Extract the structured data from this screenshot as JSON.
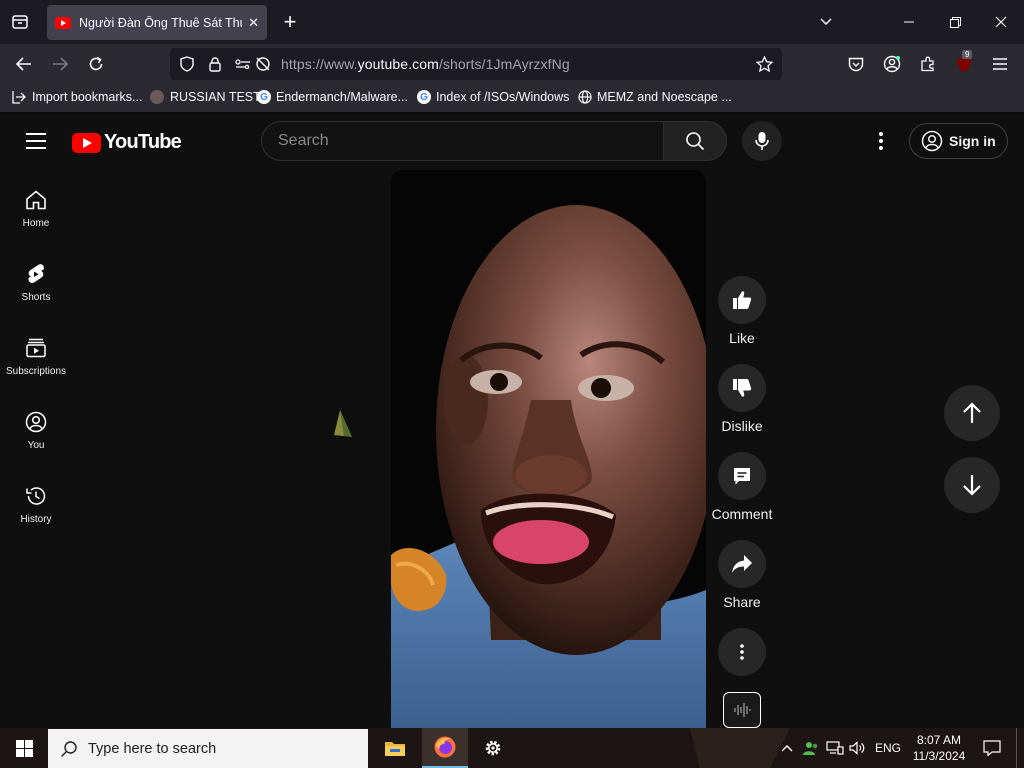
{
  "browser": {
    "tab_title": "Người Đàn Ông Thuê Sát Thủ H",
    "new_tab": "+",
    "url_prefix": "https://www.",
    "url_host": "youtube.com",
    "url_path": "/shorts/1JmAyrzxfNg",
    "extension_badge": "9",
    "bookmarks": [
      "Import bookmarks...",
      "RUSSIAN TEST",
      "Endermanch/Malware...",
      "Index of /ISOs/Windows",
      "MEMZ and Noescape ..."
    ]
  },
  "youtube": {
    "logo_text": "YouTube",
    "search_placeholder": "Search",
    "sign_in": "Sign in",
    "sidebar": [
      {
        "label": "Home",
        "icon": "home-icon"
      },
      {
        "label": "Shorts",
        "icon": "shorts-icon"
      },
      {
        "label": "Subscriptions",
        "icon": "subscriptions-icon"
      },
      {
        "label": "You",
        "icon": "you-icon"
      },
      {
        "label": "History",
        "icon": "history-icon"
      }
    ],
    "actions": {
      "like": "Like",
      "dislike": "Dislike",
      "comment": "Comment",
      "share": "Share"
    }
  },
  "taskbar": {
    "search_placeholder": "Type here to search",
    "language": "ENG",
    "time": "8:07 AM",
    "date": "11/3/2024"
  },
  "colors": {
    "brand_red": "#ff0000",
    "page_bg": "#0f0f0f",
    "button_bg": "#272727"
  }
}
